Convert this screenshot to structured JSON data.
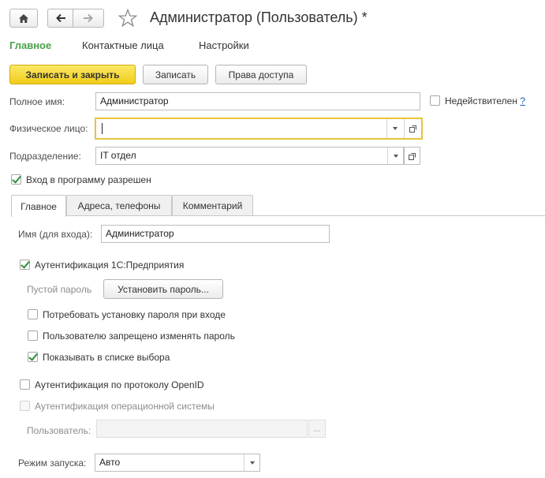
{
  "header": {
    "title": "Администратор (Пользователь) *",
    "home_icon": "home-icon",
    "back_icon": "arrow-left-icon",
    "forward_icon": "arrow-right-icon",
    "favorite_icon": "star-icon"
  },
  "nav": {
    "items": [
      {
        "label": "Главное",
        "active": true
      },
      {
        "label": "Контактные лица",
        "active": false
      },
      {
        "label": "Настройки",
        "active": false
      }
    ]
  },
  "toolbar": {
    "save_close_label": "Записать и закрыть",
    "save_label": "Записать",
    "access_rights_label": "Права доступа"
  },
  "form": {
    "full_name_label": "Полное имя:",
    "full_name_value": "Администратор",
    "invalid_label": "Недействителен",
    "help_mark": "?",
    "person_label": "Физическое лицо:",
    "person_value": "",
    "department_label": "Подразделение:",
    "department_value": "IT отдел",
    "login_allowed_label": "Вход в программу разрешен",
    "login_allowed_checked": true
  },
  "tabs": [
    {
      "label": "Главное",
      "active": true
    },
    {
      "label": "Адреса, телефоны",
      "active": false
    },
    {
      "label": "Комментарий",
      "active": false
    }
  ],
  "main_tab": {
    "login_name_label": "Имя (для входа):",
    "login_name_value": "Администратор",
    "auth_1c_label": "Аутентификация 1С:Предприятия",
    "auth_1c_checked": true,
    "empty_password_label": "Пустой пароль",
    "set_password_label": "Установить пароль...",
    "require_password_change_label": "Потребовать установку пароля при входе",
    "require_password_change_checked": false,
    "password_change_forbidden_label": "Пользователю запрещено изменять пароль",
    "password_change_forbidden_checked": false,
    "show_in_list_label": "Показывать в списке выбора",
    "show_in_list_checked": true,
    "auth_openid_label": "Аутентификация по протоколу OpenID",
    "auth_openid_checked": false,
    "auth_os_label": "Аутентификация операционной системы",
    "auth_os_checked": false,
    "os_user_label": "Пользователь:",
    "os_user_value": "",
    "os_user_select": "...",
    "launch_mode_label": "Режим запуска:",
    "launch_mode_value": "Авто"
  },
  "colors": {
    "accent_green": "#4aa14a",
    "primary_button": "#f5d52e",
    "focus_border": "#e6c43c",
    "check_green": "#2e8f3a"
  }
}
